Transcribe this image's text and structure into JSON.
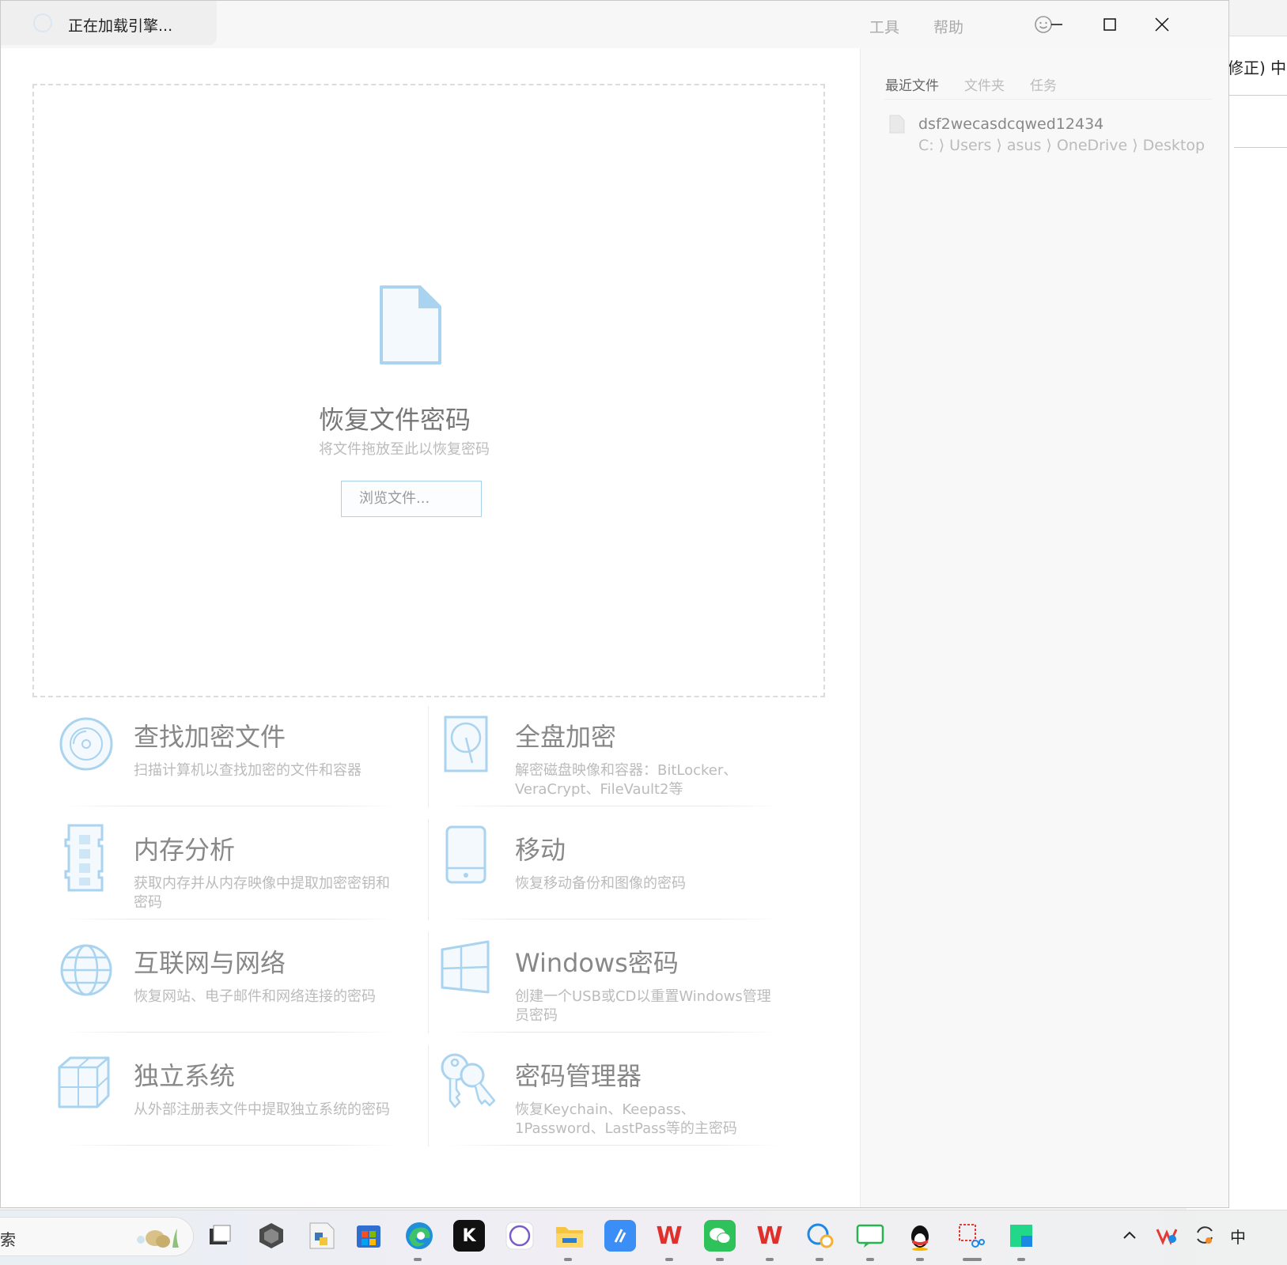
{
  "window": {
    "title": "正在加载引擎...",
    "menu_tools": "工具",
    "menu_help": "帮助"
  },
  "dropzone": {
    "title": "恢复文件密码",
    "subtitle": "将文件拖放至此以恢复密码",
    "browse_label": "浏览文件..."
  },
  "features": [
    {
      "title": "查找加密文件",
      "desc": "扫描计算机以查找加密的文件和容器",
      "icon": "disc-search-icon"
    },
    {
      "title": "全盘加密",
      "desc": "解密磁盘映像和容器：BitLocker、VeraCrypt、FileVault2等",
      "icon": "hard-disk-icon"
    },
    {
      "title": "内存分析",
      "desc": "获取内存并从内存映像中提取加密密钥和密码",
      "icon": "memory-chip-icon"
    },
    {
      "title": "移动",
      "desc": "恢复移动备份和图像的密码",
      "icon": "mobile-phone-icon"
    },
    {
      "title": "互联网与网络",
      "desc": "恢复网站、电子邮件和网络连接的密码",
      "icon": "globe-icon"
    },
    {
      "title": "Windows密码",
      "desc": "创建一个USB或CD以重置Windows管理员密码",
      "icon": "windows-logo-icon"
    },
    {
      "title": "独立系统",
      "desc": "从外部注册表文件中提取独立系统的密码",
      "icon": "cubes-icon"
    },
    {
      "title": "密码管理器",
      "desc": "恢复Keychain、Keepass、1Password、LastPass等的主密码",
      "icon": "keys-icon"
    }
  ],
  "right_panel": {
    "tabs": [
      "最近文件",
      "文件夹",
      "任务"
    ],
    "active_tab": "最近文件",
    "recent": {
      "name": "dsf2wecasdcqwed12434",
      "path": "C: ⟩ Users ⟩ asus ⟩ OneDrive ⟩ Desktop"
    }
  },
  "background_window": {
    "text": "修正) 中"
  },
  "taskbar": {
    "search_text": "索",
    "ime": "中"
  },
  "colors": {
    "accent_icon": "#a9d3ee",
    "accent_fill": "#f3f9fd"
  }
}
